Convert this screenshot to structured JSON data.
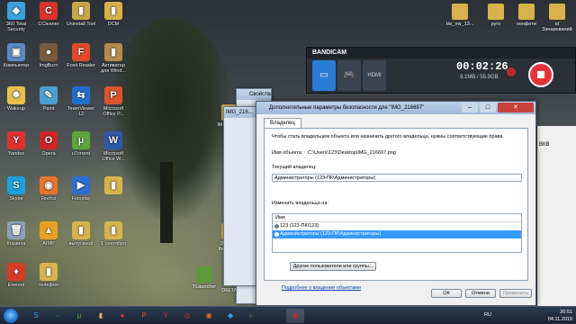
{
  "desktop_icons_left": [
    {
      "label": "360 Total Security",
      "color": "#3aa0e0",
      "glyph": "◆"
    },
    {
      "label": "CCleaner",
      "color": "#d9342b",
      "glyph": "C"
    },
    {
      "label": "Uninstall Tool",
      "color": "#c9a84a",
      "glyph": "▮"
    },
    {
      "label": "DCM",
      "color": "#d8b24a",
      "glyph": "▮"
    },
    {
      "label": "Компьютер",
      "color": "#5a8ac8",
      "glyph": "▣"
    },
    {
      "label": "ImgBurn",
      "color": "#7a5a3a",
      "glyph": "●"
    },
    {
      "label": "Foxit Reader",
      "color": "#e04a2a",
      "glyph": "F"
    },
    {
      "label": "Активатор для Wind...",
      "color": "#b58a4a",
      "glyph": "▮"
    },
    {
      "label": "Wakeup",
      "color": "#e8c24a",
      "glyph": "✹"
    },
    {
      "label": "Paint",
      "color": "#4aa0d0",
      "glyph": "✎"
    },
    {
      "label": "TeamViewer 12",
      "color": "#1f6fd0",
      "glyph": "⇆"
    },
    {
      "label": "Microsoft Office P...",
      "color": "#d9532b",
      "glyph": "P"
    },
    {
      "label": "Yandex",
      "color": "#e03030",
      "glyph": "Y"
    },
    {
      "label": "Opera",
      "color": "#d02424",
      "glyph": "O"
    },
    {
      "label": "uTorrent",
      "color": "#5aa83a",
      "glyph": "µ"
    },
    {
      "label": "Microsoft Office W...",
      "color": "#2b5aa8",
      "glyph": "W"
    },
    {
      "label": "Skype",
      "color": "#1aa0e0",
      "glyph": "S"
    },
    {
      "label": "Firefox",
      "color": "#e8742a",
      "glyph": "◉"
    },
    {
      "label": "Fotoplay",
      "color": "#2a6fd0",
      "glyph": "▶"
    },
    {
      "label": "",
      "color": "#d8b24a",
      "glyph": "▮"
    },
    {
      "label": "Корзина",
      "color": "#8aa0b8",
      "glyph": "🗑"
    },
    {
      "label": "AIMP",
      "color": "#e8a020",
      "glyph": "▲"
    },
    {
      "label": "выпускной",
      "color": "#d8b24a",
      "glyph": "▮"
    },
    {
      "label": "1 сентября",
      "color": "#d8b24a",
      "glyph": "▮"
    },
    {
      "label": "Everest",
      "color": "#d83a2a",
      "glyph": "♦"
    },
    {
      "label": "телефон",
      "color": "#d8b24a",
      "glyph": "▮"
    }
  ],
  "desktop_icons_middle": [
    {
      "label": "IMG_216...",
      "color": "#d8b24a"
    },
    {
      "label": "Это был Квадрат...",
      "color": "#d8b24a"
    },
    {
      "label": "TLauncher",
      "color": "#5a9a3a"
    },
    {
      "label": "DELTA...",
      "color": "#333333"
    }
  ],
  "desktop_icons_top_right": [
    {
      "label": "Hs_mv_13...",
      "color": "#d8b24a"
    },
    {
      "label": "руго",
      "color": "#d8b24a"
    },
    {
      "label": "конфети",
      "color": "#d8b24a"
    },
    {
      "label": "id Зачарований",
      "color": "#d8b24a"
    }
  ],
  "bandicam": {
    "title": "BANDICAM",
    "timer": "00:02:26",
    "size": "9.1MB / 55.9GB",
    "modes": [
      "▭",
      "🎮",
      "HDMI"
    ],
    "rec_color": "#e2353a"
  },
  "back_windows": {
    "properties_title": "Свойства: IMG_216697",
    "back_title": "IMG_216..."
  },
  "dialog": {
    "title": "Дополнительные параметры безопасности  для \"IMG_216697\"",
    "close_glyph": "✕",
    "min_glyph": "–",
    "max_glyph": "□",
    "tab": "Владелец",
    "description": "Чтобы стать владельцем объекта или назначить другого владельца, нужны соответствующие права.",
    "object_name_label": "Имя объекта:",
    "object_name_value": "C:\\Users\\123\\Desktop\\IMG_216697.png",
    "current_owner_label": "Текущий владелец:",
    "current_owner_value": "Администраторы (123-ПК\\Администраторы)",
    "change_owner_label": "Изменить владельца на:",
    "list_header": "Имя",
    "list_rows": [
      {
        "text": "123 (123-ПК\\123)",
        "selected": false
      },
      {
        "text": "Администраторы (123-ПК\\Администраторы)",
        "selected": true
      }
    ],
    "other_users_button": "Другие пользователи или группы...",
    "learn_more_link": "Подробнее о владении объектами",
    "ok_button": "ОК",
    "cancel_button": "Отмена",
    "apply_button": "Применить"
  },
  "right_window": {
    "text": "ВКВ"
  },
  "taskbar": {
    "apps": [
      "S",
      "⇔",
      "µ",
      "▮",
      "●",
      "P",
      "Y",
      "◎",
      "◉",
      "◆",
      "▶",
      "≡",
      "◉"
    ],
    "language": "RU",
    "time": "20:51",
    "date": "04.11.2019"
  }
}
